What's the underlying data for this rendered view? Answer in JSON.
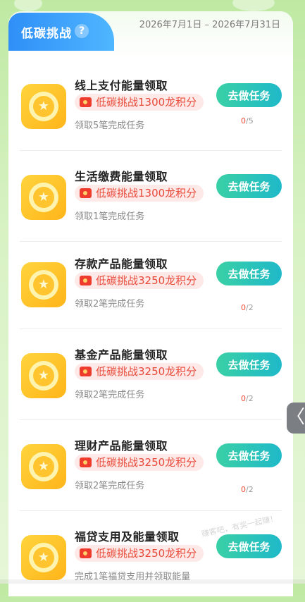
{
  "header": {
    "title": "低碳挑战",
    "help_icon": "?",
    "date_range": "2026年7月1日 – 2026年7月31日"
  },
  "button_label": "去做任务",
  "tasks": [
    {
      "title": "线上支付能量领取",
      "reward": "低碳挑战1300龙积分",
      "desc": "领取5笔完成任务",
      "progress_current": "0",
      "progress_sep": "/",
      "progress_total": "5"
    },
    {
      "title": "生活缴费能量领取",
      "reward": "低碳挑战1300龙积分",
      "desc": "领取1笔完成任务",
      "progress_current": "",
      "progress_sep": "",
      "progress_total": ""
    },
    {
      "title": "存款产品能量领取",
      "reward": "低碳挑战3250龙积分",
      "desc": "领取2笔完成任务",
      "progress_current": "0",
      "progress_sep": "/",
      "progress_total": "2"
    },
    {
      "title": "基金产品能量领取",
      "reward": "低碳挑战3250龙积分",
      "desc": "领取2笔完成任务",
      "progress_current": "0",
      "progress_sep": "/",
      "progress_total": "2"
    },
    {
      "title": "理财产品能量领取",
      "reward": "低碳挑战3250龙积分",
      "desc": "领取2笔完成任务",
      "progress_current": "0",
      "progress_sep": "/",
      "progress_total": "2"
    },
    {
      "title": "福贷支用及能量领取",
      "reward": "低碳挑战3250龙积分",
      "desc": "完成1笔福贷支用并领取能量",
      "progress_current": "",
      "progress_sep": "",
      "progress_total": ""
    }
  ],
  "side_handle": "〈",
  "watermark": "赚客吧，有奖一起赚！",
  "colors": {
    "accent": "#1fb9c9",
    "reward_text": "#e84a3a",
    "tab_blue": "#2f8ff7"
  },
  "icons": {
    "coin": "star-coin-icon",
    "reward": "red-envelope-icon"
  }
}
